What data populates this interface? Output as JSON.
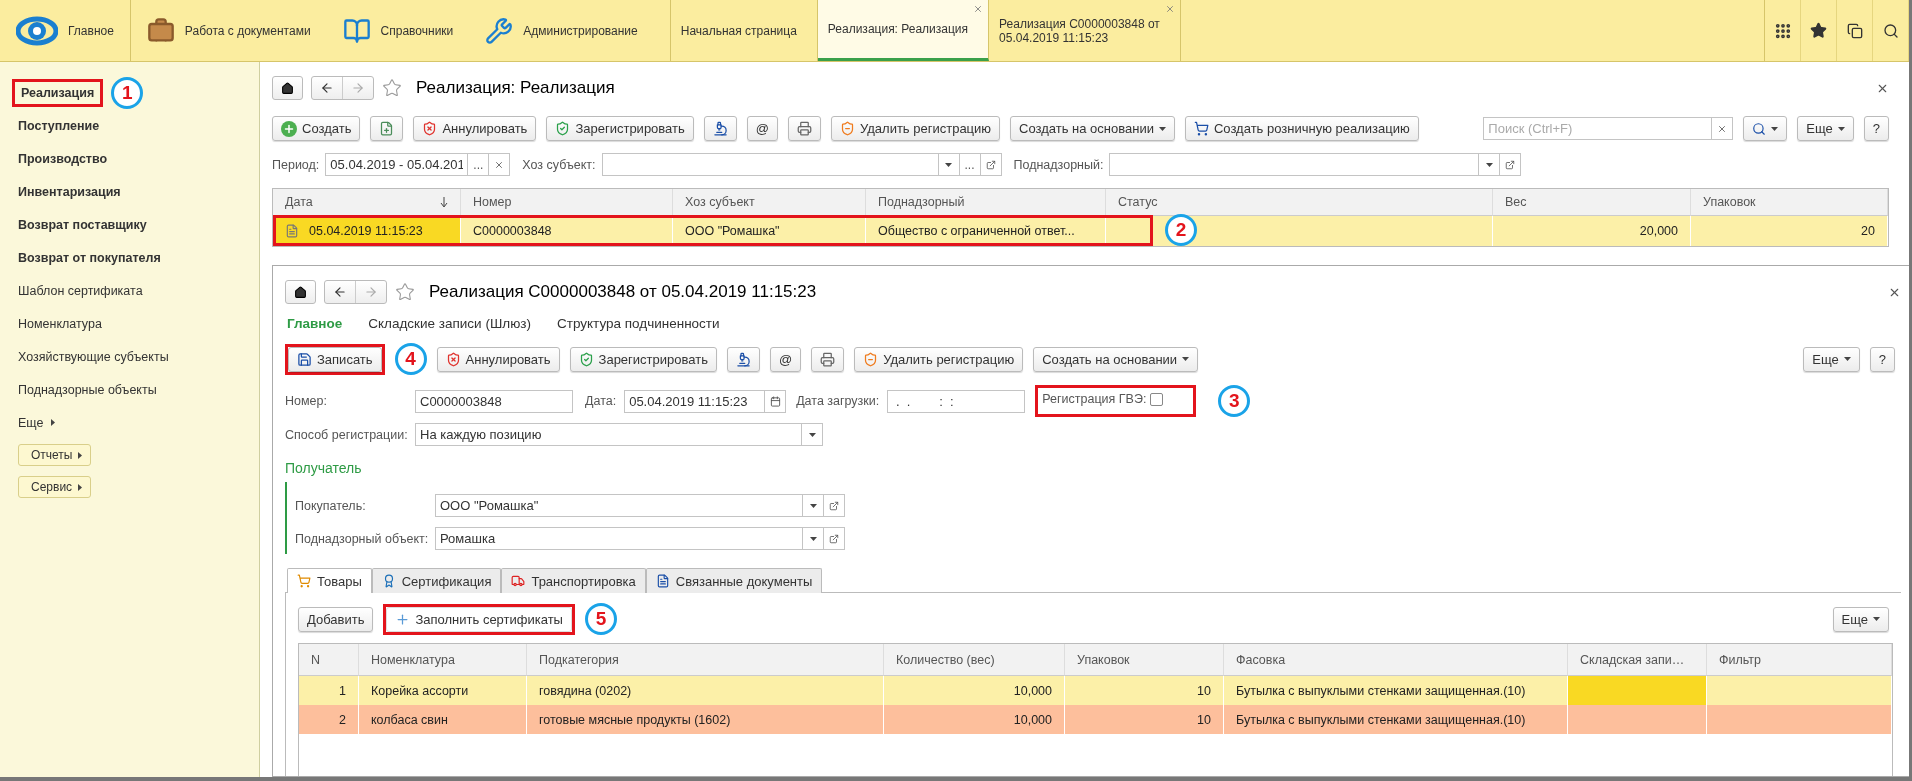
{
  "app_bar": {
    "sections": [
      {
        "label": "Главное",
        "kind": "home"
      },
      {
        "label": "Работа с документами",
        "kind": "documents"
      },
      {
        "label": "Справочники",
        "kind": "directories"
      },
      {
        "label": "Администрирование",
        "kind": "admin"
      }
    ],
    "open_tabs": [
      {
        "lines": [
          "Начальная страница"
        ],
        "selected": false,
        "closable": false
      },
      {
        "lines": [
          "Реализация: Реализация"
        ],
        "selected": true,
        "closable": true
      },
      {
        "lines": [
          "Реализация C0000003848 от",
          "05.04.2019 11:15:23"
        ],
        "selected": false,
        "closable": true
      }
    ]
  },
  "sidebar": {
    "items": [
      {
        "label": "Реализация",
        "bold": true,
        "annotation": "1"
      },
      {
        "label": "Поступление",
        "bold": true
      },
      {
        "label": "Производство",
        "bold": true
      },
      {
        "label": "Инвентаризация",
        "bold": true
      },
      {
        "label": "Возврат поставщику",
        "bold": true
      },
      {
        "label": "Возврат от покупателя",
        "bold": true
      },
      {
        "label": "Шаблон сертификата",
        "bold": false
      },
      {
        "label": "Номенклатура",
        "bold": false
      },
      {
        "label": "Хозяйствующие субъекты",
        "bold": false
      },
      {
        "label": "Поднадзорные объекты",
        "bold": false
      }
    ],
    "more": "Еще",
    "buttons": [
      "Отчеты",
      "Сервис"
    ]
  },
  "list_form": {
    "title": "Реализация: Реализация",
    "toolbar": [
      {
        "kind": "create",
        "label": "Создать"
      },
      {
        "kind": "copy"
      },
      {
        "kind": "cancel",
        "label": "Аннулировать"
      },
      {
        "kind": "register",
        "label": "Зарегистрировать"
      },
      {
        "kind": "inspect"
      },
      {
        "kind": "text",
        "label": "@"
      },
      {
        "kind": "print"
      },
      {
        "kind": "unregister",
        "label": "Удалить регистрацию"
      },
      {
        "kind": "menu",
        "label": "Создать на основании"
      },
      {
        "kind": "retail",
        "label": "Создать розничную реализацию"
      }
    ],
    "search": {
      "placeholder": "Поиск (Ctrl+F)"
    },
    "more": "Еще",
    "help": "?",
    "filters": [
      {
        "label": "Период:",
        "value": "05.04.2019 - 05.04.201",
        "kind": "period",
        "choose": "..."
      },
      {
        "label": "Хоз субъект:",
        "kind": "choice",
        "choose": "..."
      },
      {
        "label": "Поднадзорный:",
        "kind": "choice"
      }
    ],
    "table": {
      "columns": [
        {
          "label": "Дата",
          "sorted": true
        },
        {
          "label": "Номер",
          "sorted": false
        },
        {
          "label": "Хоз субъект",
          "sorted": false
        },
        {
          "label": "Поднадзорный",
          "sorted": false
        },
        {
          "label": "Статус",
          "sorted": false
        },
        {
          "label": "Вес",
          "sorted": false
        },
        {
          "label": "Упаковок",
          "sorted": false
        }
      ],
      "rows": [
        {
          "cells": [
            "05.04.2019 11:15:23",
            "C0000003848",
            "ООО \"Ромашка\"",
            "Общество с ограниченной ответ...",
            null,
            "20,000",
            "20"
          ],
          "selected": true,
          "annotation": "2"
        }
      ]
    }
  },
  "document_form": {
    "title": "Реализация C0000003848 от 05.04.2019 11:15:23",
    "nav": [
      {
        "label": "Главное",
        "selected": true
      },
      {
        "label": "Складские записи (Шлюз)",
        "selected": false
      },
      {
        "label": "Структура подчиненности",
        "selected": false
      }
    ],
    "toolbar": [
      {
        "kind": "save",
        "label": "Записать",
        "annotation": "4"
      },
      {
        "kind": "cancel",
        "label": "Аннулировать"
      },
      {
        "kind": "register",
        "label": "Зарегистрировать"
      },
      {
        "kind": "inspect"
      },
      {
        "kind": "text",
        "label": "@"
      },
      {
        "kind": "print"
      },
      {
        "kind": "unregister",
        "label": "Удалить регистрацию"
      },
      {
        "kind": "menu",
        "label": "Создать на основании"
      }
    ],
    "more": "Еще",
    "help": "?",
    "number": {
      "label": "Номер:",
      "value": "C0000003848"
    },
    "date": {
      "label": "Дата:",
      "value": "05.04.2019 11:15:23"
    },
    "load_date": {
      "label": "Дата загрузки:",
      "value": " .  .        :  :"
    },
    "gve": {
      "label": "Регистрация ГВЭ:",
      "checked": false,
      "annotation": "3"
    },
    "method": {
      "label": "Способ регистрации:",
      "value": "На каждую позицию"
    },
    "recipient": {
      "title": "Получатель",
      "fields": [
        {
          "label": "Покупатель:",
          "value": "ООО \"Ромашка\""
        },
        {
          "label": "Поднадзорный объект:",
          "value": "Ромашка"
        }
      ]
    },
    "tabs": [
      {
        "label": "Товары",
        "kind": "goods",
        "selected": true
      },
      {
        "label": "Сертификация",
        "kind": "certification",
        "selected": false
      },
      {
        "label": "Транспортировка",
        "kind": "transport",
        "selected": false
      },
      {
        "label": "Связанные документы",
        "kind": "documents",
        "selected": false
      }
    ],
    "goods_toolbar": [
      {
        "kind": "plain",
        "label": "Добавить"
      },
      {
        "kind": "fill",
        "label": "Заполнить сертификаты",
        "annotation": "5"
      }
    ],
    "goods_more": "Еще",
    "table": {
      "columns": [
        "N",
        "Номенклатура",
        "Подкатегория",
        "Количество (вес)",
        "Упаковок",
        "Фасовка",
        "Складская запи…",
        "Фильтр"
      ],
      "rows": [
        {
          "cells": [
            "1",
            "Корейка ассорти",
            "говядина (0202)",
            "10,000",
            "10",
            "Бутылка с выпуклыми стенками защищенная.(10)",
            null,
            null
          ],
          "selected": true,
          "color": "#fcf0a8"
        },
        {
          "cells": [
            "2",
            "колбаса свин",
            "готовые мясные продукты (1602)",
            "10,000",
            "10",
            "Бутылка с выпуклыми стенками защищенная.(10)",
            null,
            null
          ],
          "selected": false,
          "color": "#fdbf9c"
        }
      ]
    }
  }
}
